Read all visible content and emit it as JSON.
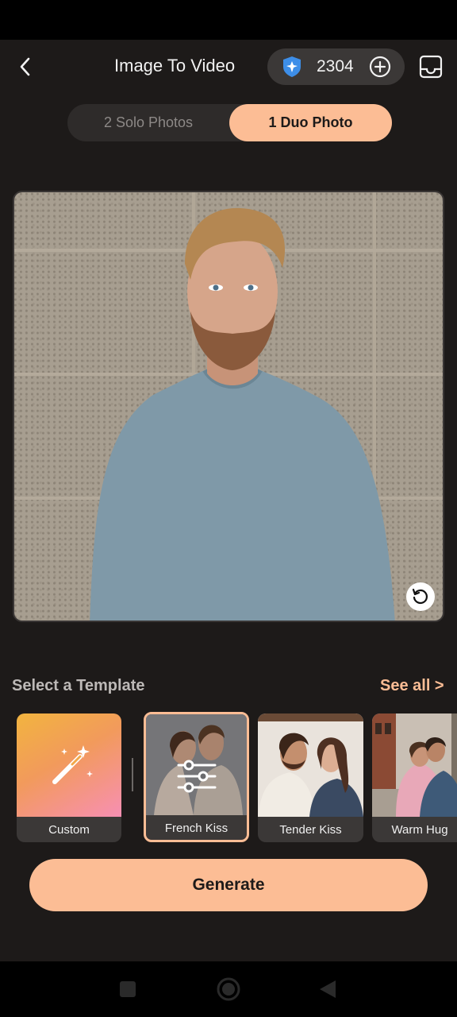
{
  "header": {
    "title": "Image To Video",
    "credits": "2304"
  },
  "mode_tabs": [
    {
      "label": "2 Solo Photos",
      "selected": false
    },
    {
      "label": "1 Duo Photo",
      "selected": true
    }
  ],
  "templates_section": {
    "title": "Select a Template",
    "see_all": "See all >",
    "items": [
      {
        "label": "Custom",
        "icon": "magic-wand-icon"
      },
      {
        "label": "French Kiss",
        "selected": true,
        "icon": "sliders-icon"
      },
      {
        "label": "Tender Kiss"
      },
      {
        "label": "Warm Hug"
      }
    ]
  },
  "generate_label": "Generate",
  "colors": {
    "accent": "#fcbd95",
    "background": "#1d1a19"
  }
}
